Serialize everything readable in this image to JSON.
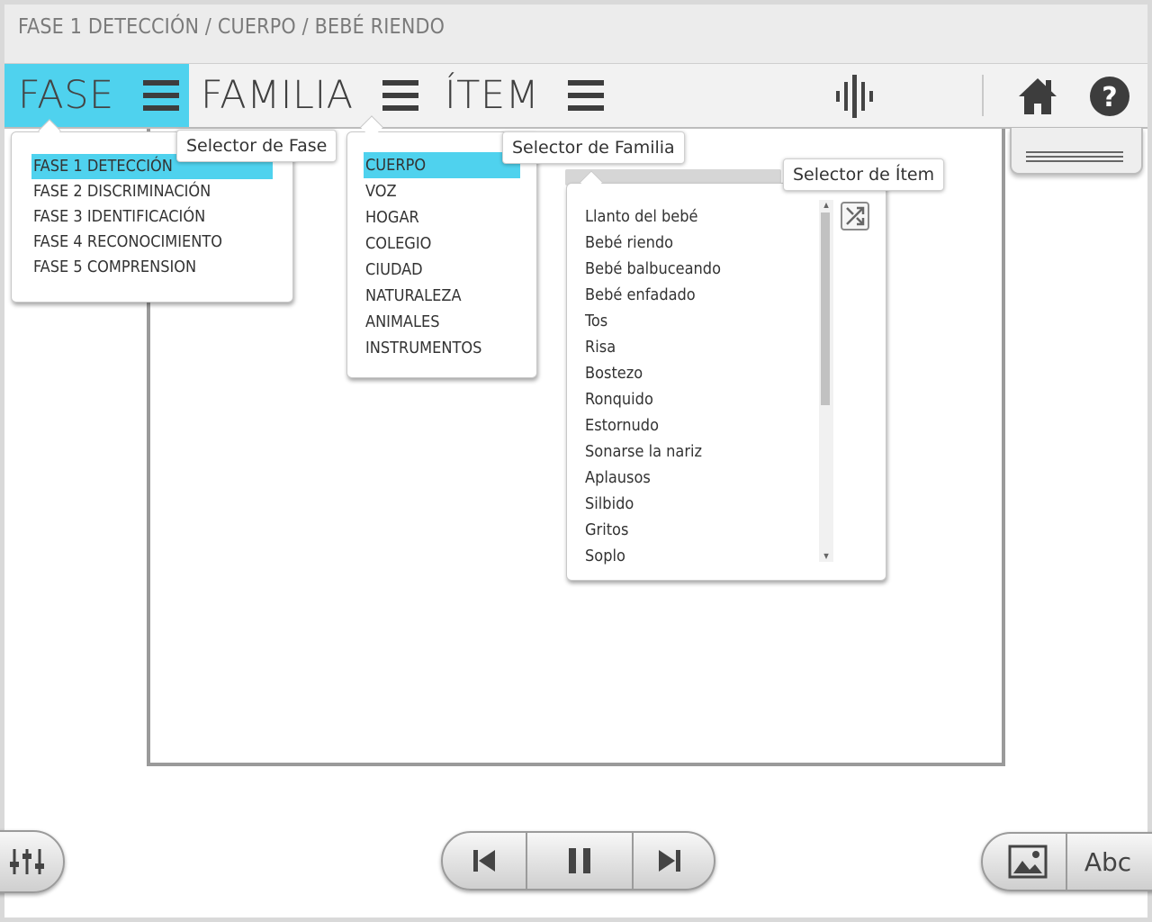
{
  "breadcrumb": "FASE 1 DETECCIÓN / CUERPO / BEBÉ RIENDO",
  "nav": {
    "fase_label": "FASE",
    "familia_label": "FAMILIA",
    "item_label": "ÍTEM",
    "icons": [
      "audio-waveform-icon",
      "home-icon",
      "help-icon"
    ],
    "accent": "#4fd2ee"
  },
  "tooltips": {
    "fase": "Selector de Fase",
    "familia": "Selector de Familia",
    "item": "Selector de Ítem"
  },
  "fase_menu": {
    "items": [
      "FASE 1 DETECCIÓN",
      "FASE 2 DISCRIMINACIÓN",
      "FASE 3 IDENTIFICACIÓN",
      "FASE 4 RECONOCIMIENTO",
      "FASE 5 COMPRENSION"
    ],
    "selected": 0
  },
  "familia_menu": {
    "items": [
      "CUERPO",
      "VOZ",
      "HOGAR",
      "COLEGIO",
      "CIUDAD",
      "NATURALEZA",
      "ANIMALES",
      "INSTRUMENTOS"
    ],
    "selected": 0
  },
  "item_menu": {
    "items": [
      "Llanto del bebé",
      "Bebé riendo",
      "Bebé balbuceando",
      "Bebé enfadado",
      "Tos",
      "Risa",
      "Bostezo",
      "Ronquido",
      "Estornudo",
      "Sonarse la nariz",
      "Aplausos",
      "Silbido",
      "Gritos",
      "Soplo"
    ]
  },
  "bottom": {
    "left_icon": "sliders-icon",
    "player_icons": [
      "skip-back-icon",
      "pause-icon",
      "skip-forward-icon"
    ],
    "image_icon": "image-icon",
    "text_button": "Abc"
  }
}
